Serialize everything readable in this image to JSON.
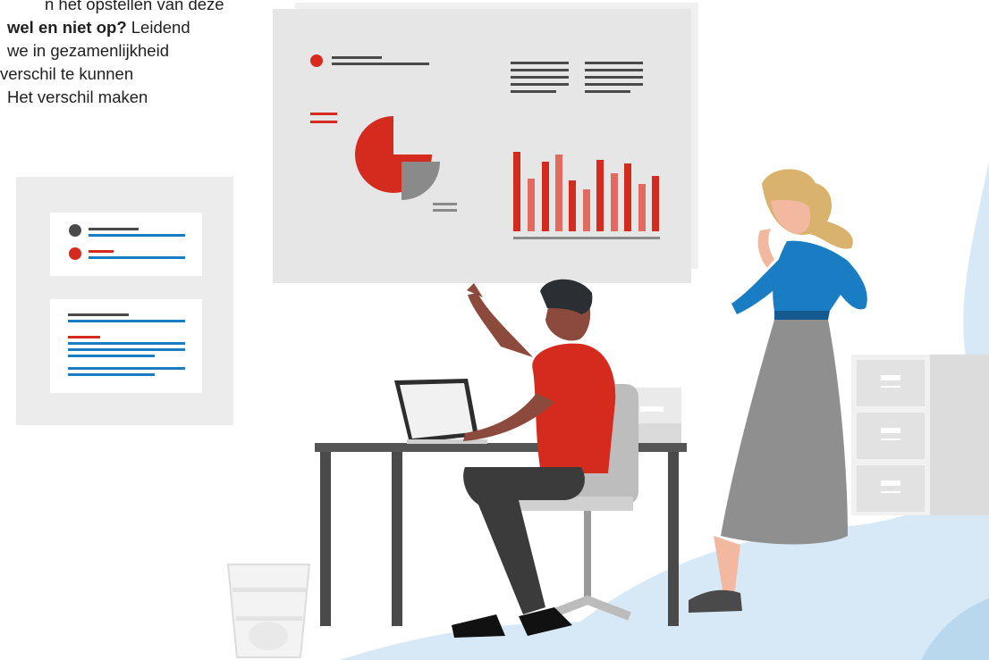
{
  "intro_text": {
    "line_1": "n het opstellen van deze",
    "line_2_bold": "wel en niet op?",
    "line_2_rest": " Leidend",
    "line_3": "we in gezamenlijkheid",
    "line_4": "verschil te kunnen",
    "line_5": "Het verschil maken"
  },
  "colors": {
    "accent_red": "#d52b1e",
    "light_red": "#e36a61",
    "blue": "#1a7dc4",
    "dark_gray": "#4a4a4a",
    "panel_gray": "#e8e8e8",
    "light_blue_bg": "#d7e9f6"
  },
  "illustration": {
    "presentation_board_icons": [
      "dot-list-icon",
      "pie-chart-icon",
      "bar-chart-icon",
      "text-lines-icon"
    ],
    "side_card_icons": [
      "list-card-icon",
      "text-card-icon"
    ],
    "figures": [
      "seated-man-pointing",
      "standing-woman-thinking"
    ],
    "objects": [
      "laptop-icon",
      "desk-icon",
      "office-chair-icon",
      "filing-cabinet-icon",
      "wastebasket-icon",
      "paper-tray-icon"
    ]
  }
}
